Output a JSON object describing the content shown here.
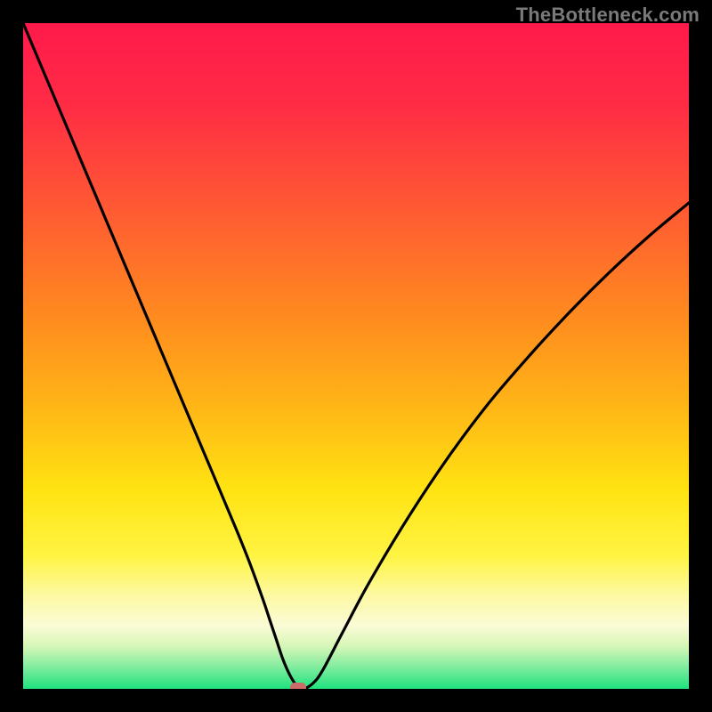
{
  "watermark": "TheBottleneck.com",
  "colors": {
    "page_bg": "#000000",
    "curve": "#000000",
    "marker": "#cb6c68",
    "gradient_stops": [
      {
        "offset": 0.0,
        "color": "#ff1a4b"
      },
      {
        "offset": 0.12,
        "color": "#ff2b45"
      },
      {
        "offset": 0.28,
        "color": "#ff5a33"
      },
      {
        "offset": 0.44,
        "color": "#ff8a1f"
      },
      {
        "offset": 0.58,
        "color": "#ffb716"
      },
      {
        "offset": 0.7,
        "color": "#ffe312"
      },
      {
        "offset": 0.8,
        "color": "#fff443"
      },
      {
        "offset": 0.86,
        "color": "#fdf9a3"
      },
      {
        "offset": 0.905,
        "color": "#fbfbd6"
      },
      {
        "offset": 0.935,
        "color": "#d8f6b8"
      },
      {
        "offset": 0.965,
        "color": "#87eda0"
      },
      {
        "offset": 1.0,
        "color": "#1fe27e"
      }
    ]
  },
  "chart_data": {
    "type": "line",
    "title": "",
    "xlabel": "",
    "ylabel": "",
    "xlim": [
      0,
      100
    ],
    "ylim": [
      0,
      100
    ],
    "grid": false,
    "legend": false,
    "series": [
      {
        "name": "bottleneck-curve",
        "x": [
          0,
          4,
          8,
          12,
          16,
          20,
          24,
          28,
          32,
          34,
          36,
          37,
          38,
          39,
          40,
          41,
          42,
          43.5,
          45,
          48,
          52,
          58,
          64,
          70,
          76,
          82,
          88,
          94,
          100
        ],
        "y": [
          100,
          90.5,
          81,
          71.5,
          62,
          52.5,
          43,
          33.5,
          24,
          19,
          13.5,
          10.5,
          7.5,
          4.5,
          2.2,
          0.6,
          0.0,
          0.8,
          2.8,
          8.5,
          16,
          26,
          35,
          43,
          50,
          56.5,
          62.5,
          68,
          73
        ]
      }
    ],
    "annotations": [
      {
        "name": "min-marker",
        "x": 41.3,
        "y": 0.1
      }
    ]
  }
}
